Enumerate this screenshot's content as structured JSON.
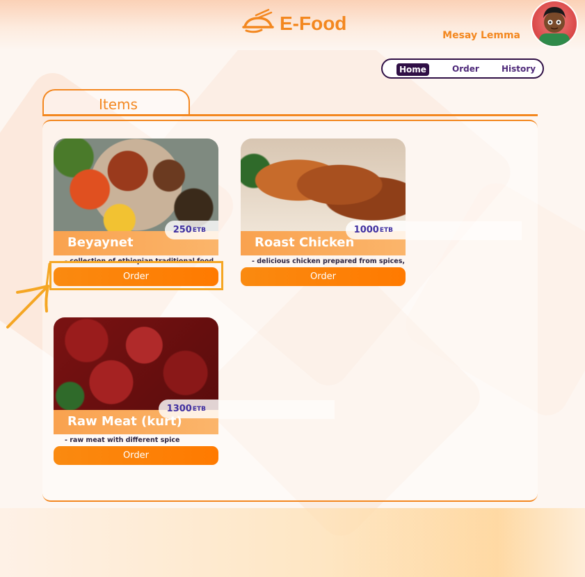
{
  "app": {
    "title": "E-Food"
  },
  "user": {
    "name": "Mesay Lemma"
  },
  "nav": {
    "home": "Home",
    "order": "Order",
    "history": "History"
  },
  "section": {
    "title": "Items"
  },
  "currency": "ETB",
  "items": [
    {
      "name": "Beyaynet",
      "price": "250",
      "description": "- collection of ethiopian traditional food",
      "button": "Order"
    },
    {
      "name": "Roast Chicken",
      "price": "1000",
      "description": "- delicious chicken prepared from spices, ...",
      "button": "Order"
    },
    {
      "name": "Raw Meat (kurt)",
      "price": "1300",
      "description": "- raw meat with different spice",
      "button": "Order"
    }
  ],
  "colors": {
    "accent": "#f3871f",
    "nav": "#2f0f45",
    "price": "#4030a0",
    "highlight": "#f5a623"
  }
}
